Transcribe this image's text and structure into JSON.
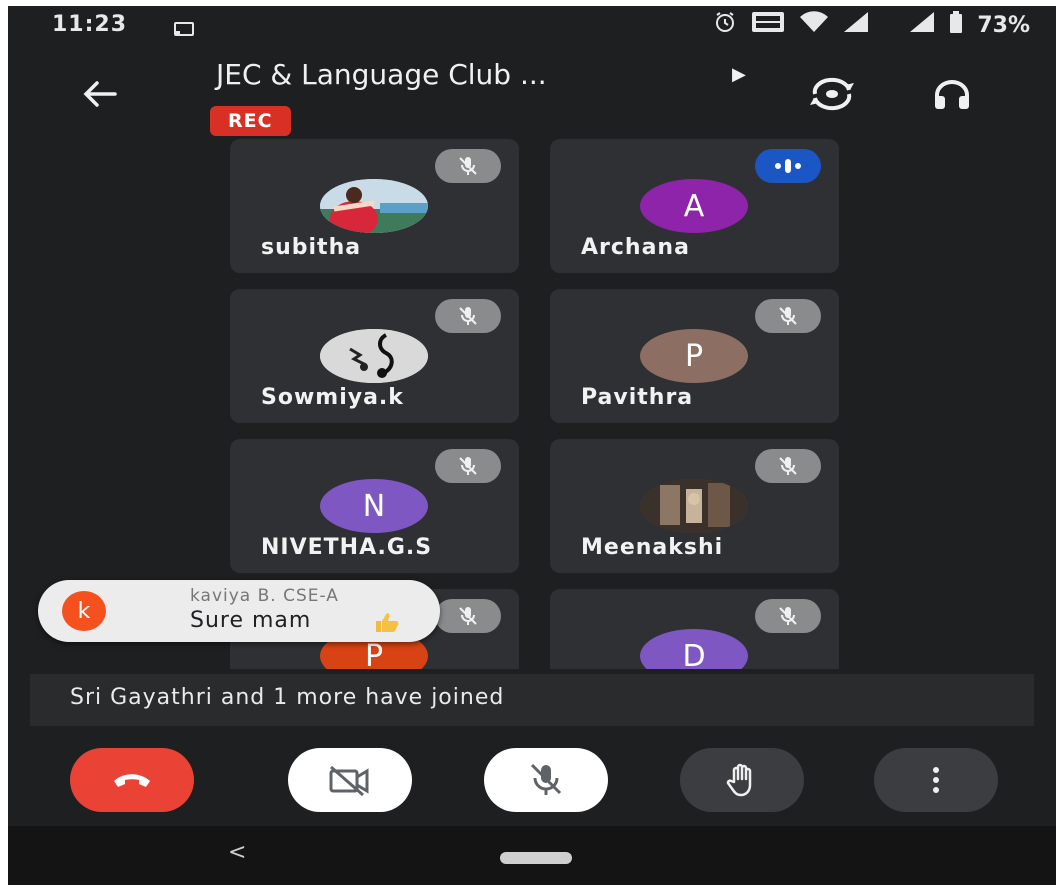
{
  "status_bar": {
    "time": "11:23",
    "battery_percent": "73%",
    "icons": [
      "cast-icon",
      "alarm-icon",
      "volte-icon",
      "wifi-icon",
      "signal-icon",
      "signal-icon",
      "battery-icon"
    ]
  },
  "header": {
    "title": "JEC & Language Club ...",
    "recording_label": "REC"
  },
  "participants": [
    {
      "name": "subitha",
      "avatar_type": "photo",
      "muted": true
    },
    {
      "name": "Archana",
      "avatar_letter": "A",
      "avatar_color": "#8e24aa",
      "muted": false,
      "speaking": true
    },
    {
      "name": "Sowmiya.k",
      "avatar_type": "photo",
      "muted": true
    },
    {
      "name": "Pavithra",
      "avatar_letter": "P",
      "avatar_color": "#8d6e63",
      "muted": true
    },
    {
      "name": "NIVETHA.G.S",
      "avatar_letter": "N",
      "avatar_color": "#7e57c2",
      "muted": true
    },
    {
      "name": "Meenakshi",
      "avatar_type": "photo",
      "muted": true
    },
    {
      "name": "",
      "avatar_letter": "P",
      "avatar_color": "#d84315",
      "muted": true
    },
    {
      "name": "",
      "avatar_letter": "D",
      "avatar_color": "#7e57c2",
      "muted": true
    }
  ],
  "chat_toast": {
    "avatar_letter": "k",
    "avatar_color": "#f4511e",
    "sender": "kaviya B. CSE-A",
    "message": "Sure mam"
  },
  "join_banner": {
    "text": "Sri Gayathri and 1 more have joined"
  },
  "controls": {
    "end_call_color": "#ea4335",
    "icons": [
      "end-call-icon",
      "camera-off-icon",
      "mic-off-icon",
      "raise-hand-icon",
      "more-vert-icon"
    ]
  },
  "nav": {
    "back_glyph": "<"
  }
}
